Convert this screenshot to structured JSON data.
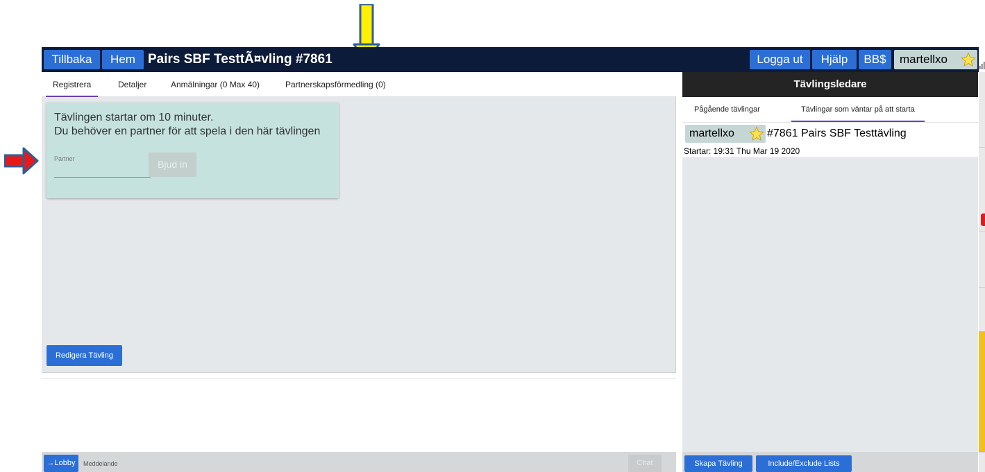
{
  "topbar": {
    "back_label": "Tillbaka",
    "home_label": "Hem",
    "title": "Pairs SBF TesttÃ¤vling #7861",
    "logout_label": "Logga ut",
    "help_label": "Hjälp",
    "bbdollars_label": "BB$",
    "username": "martellxo"
  },
  "left_tabs": [
    {
      "label": "Registrera"
    },
    {
      "label": "Detaljer"
    },
    {
      "label": "Anmälningar (0 Max 40)"
    },
    {
      "label": "Partnerskapsförmedling (0)"
    }
  ],
  "register_card": {
    "line1": "Tävlingen startar om 10 minuter.",
    "line2": "Du behöver en partner för att spela i den här tävlingen",
    "partner_label": "Partner",
    "partner_value": "",
    "invite_label": "Bjud in"
  },
  "edit_button_label": "Redigera Tävling",
  "chat": {
    "lobby_label": "→Lobby",
    "message_placeholder": "Meddelande",
    "chat_label": "Chat"
  },
  "right_panel": {
    "header": "Tävlingsledare",
    "tabs": [
      {
        "label": "Pågående tävlingar"
      },
      {
        "label": "Tävlingar som väntar på att starta"
      }
    ],
    "tournament": {
      "host": "martellxo",
      "name": "#7861 Pairs SBF Testtävling",
      "start": "Startar: 19:31 Thu Mar 19 2020"
    },
    "create_label": "Skapa Tävling",
    "lists_label": "Include/Exclude Lists"
  },
  "colors": {
    "topbar_bg": "#0c1b3a",
    "button_blue": "#2b6fd6",
    "card_bg": "#c5e2df",
    "tab_active": "#6a3fb5",
    "annotation_yellow": "#ffef00",
    "annotation_red": "#e81919",
    "vertical_tab_active": "#f3bf1f",
    "badge_red": "#e01b1b"
  }
}
